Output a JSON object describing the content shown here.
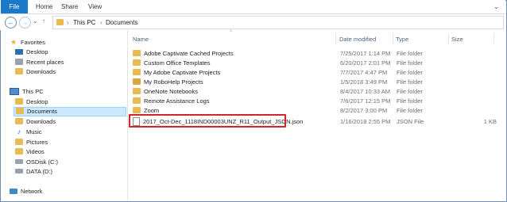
{
  "ribbon": {
    "file": "File",
    "tabs": [
      "Home",
      "Share",
      "View"
    ]
  },
  "address": {
    "back": "←",
    "forward": "→",
    "recent": "⌄",
    "up": "↑",
    "separator": "›",
    "crumbs": [
      "This PC",
      "Documents"
    ]
  },
  "sidebar": {
    "favorites": "Favorites",
    "fav_items": [
      "Desktop",
      "Recent places",
      "Downloads"
    ],
    "this_pc": "This PC",
    "pc_items": [
      "Desktop",
      "Documents",
      "Downloads",
      "Music",
      "Pictures",
      "Videos",
      "OSDisk (C:)",
      "DATA (D:)"
    ],
    "network": "Network"
  },
  "columns": {
    "name": "Name",
    "date": "Date modified",
    "type": "Type",
    "size": "Size"
  },
  "files": [
    {
      "name": "Adobe Captivate Cached Projects",
      "date": "7/25/2017 1:14 PM",
      "type": "File folder",
      "size": ""
    },
    {
      "name": "Custom Office Templates",
      "date": "6/20/2017 2:01 PM",
      "type": "File folder",
      "size": ""
    },
    {
      "name": "My Adobe Captivate Projects",
      "date": "7/7/2017 4:47 PM",
      "type": "File folder",
      "size": ""
    },
    {
      "name": "My RoboHelp Projects",
      "date": "1/5/2018 3:49 PM",
      "type": "File folder",
      "size": ""
    },
    {
      "name": "OneNote Notebooks",
      "date": "8/4/2017 10:33 AM",
      "type": "File folder",
      "size": ""
    },
    {
      "name": "Remote Assistance Logs",
      "date": "7/6/2017 12:15 PM",
      "type": "File folder",
      "size": ""
    },
    {
      "name": "Zoom",
      "date": "8/2/2017 3:00 PM",
      "type": "File folder",
      "size": ""
    },
    {
      "name": "2017_Oct-Dec_1118IND00003UNZ_R11_Output_JSON.json",
      "date": "1/16/2018 2:55 PM",
      "type": "JSON File",
      "size": "1 KB"
    }
  ],
  "colors": {
    "accent": "#1979ca",
    "highlight": "#d5232a",
    "selected": "#cce8ff"
  }
}
